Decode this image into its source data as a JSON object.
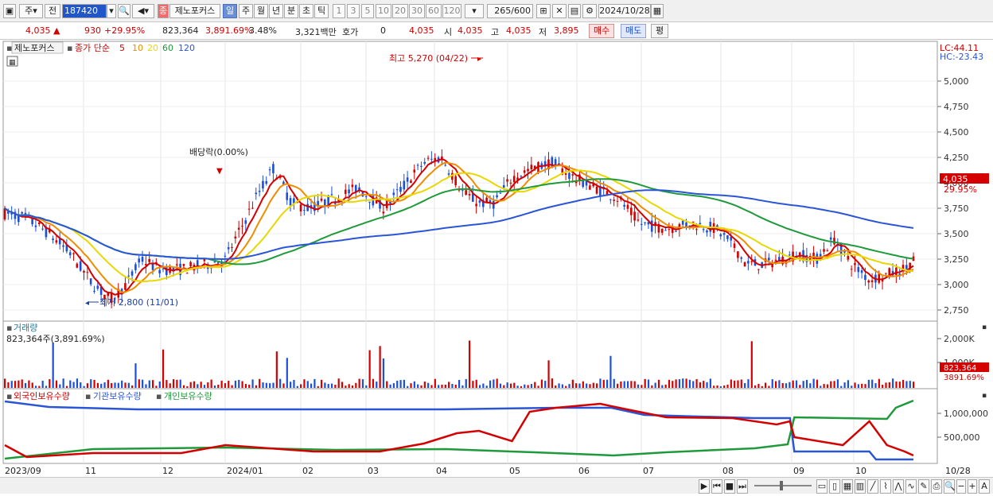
{
  "toolbar": {
    "period_main": "주",
    "prev_label": "전",
    "code": "187420",
    "badge_label": "종",
    "stock_name": "제노포커스",
    "periods": [
      "일",
      "주",
      "월",
      "년",
      "분",
      "초",
      "틱"
    ],
    "active_period": "일",
    "multipliers": [
      "1",
      "3",
      "5",
      "10",
      "20",
      "30",
      "60",
      "120"
    ],
    "count": "265",
    "count_total": "/600",
    "date": "2024/10/28"
  },
  "quote": {
    "price": "4,035",
    "change": "930",
    "change_pct": "+29.95%",
    "volume": "823,364",
    "volume_pct": "3,891.69%",
    "turnover_pct": "3.48%",
    "amount": "3,321백만",
    "bid_label": "호가",
    "bid_value": "0",
    "bid_price": "4,035",
    "open_label": "시",
    "open": "4,035",
    "high_label": "고",
    "high": "4,035",
    "low_label": "저",
    "low": "3,895",
    "buy_label": "매수",
    "sell_label": "매도",
    "eval_label": "평"
  },
  "price_panel": {
    "stock_label": "제노포커스",
    "legend_title": "종가 단순",
    "ma": [
      {
        "period": "5",
        "color": "#d40000"
      },
      {
        "period": "10",
        "color": "#f08c00"
      },
      {
        "period": "20",
        "color": "#e8d800"
      },
      {
        "period": "60",
        "color": "#1f9a3a"
      },
      {
        "period": "120",
        "color": "#2a55d6"
      }
    ],
    "lc": "LC:44.11",
    "hc": "HC:-23.43",
    "high_annotation": "최고 5,270 (04/22)",
    "low_annotation": "최저 2,800 (11/01)",
    "dividend_annotation": "배당락(0.00%)",
    "current_price_tag": "4,035",
    "current_change_tag": "29.95%",
    "y_ticks": [
      "5,000",
      "4,750",
      "4,500",
      "4,250",
      "4,000",
      "3,750",
      "3,500",
      "3,250",
      "3,000",
      "2,750"
    ]
  },
  "volume_panel": {
    "title": "거래량",
    "value_label": "823,364주(3,891.69%)",
    "y_ticks": [
      "2,000K",
      "1,000K"
    ],
    "tag_value": "823,364",
    "tag_pct": "3891.69%"
  },
  "holding_panel": {
    "legend": [
      {
        "name": "외국인보유수량",
        "color": "#d40000"
      },
      {
        "name": "기관보유수량",
        "color": "#2a55d6"
      },
      {
        "name": "개인보유수량",
        "color": "#1f9a3a"
      }
    ],
    "y_ticks": [
      "1,000,000",
      "500,000"
    ]
  },
  "x_axis": {
    "labels": [
      "2023/09",
      "11",
      "12",
      "2024/01",
      "02",
      "03",
      "04",
      "05",
      "06",
      "07",
      "08",
      "09",
      "10"
    ],
    "end_label": "10/28"
  }
}
